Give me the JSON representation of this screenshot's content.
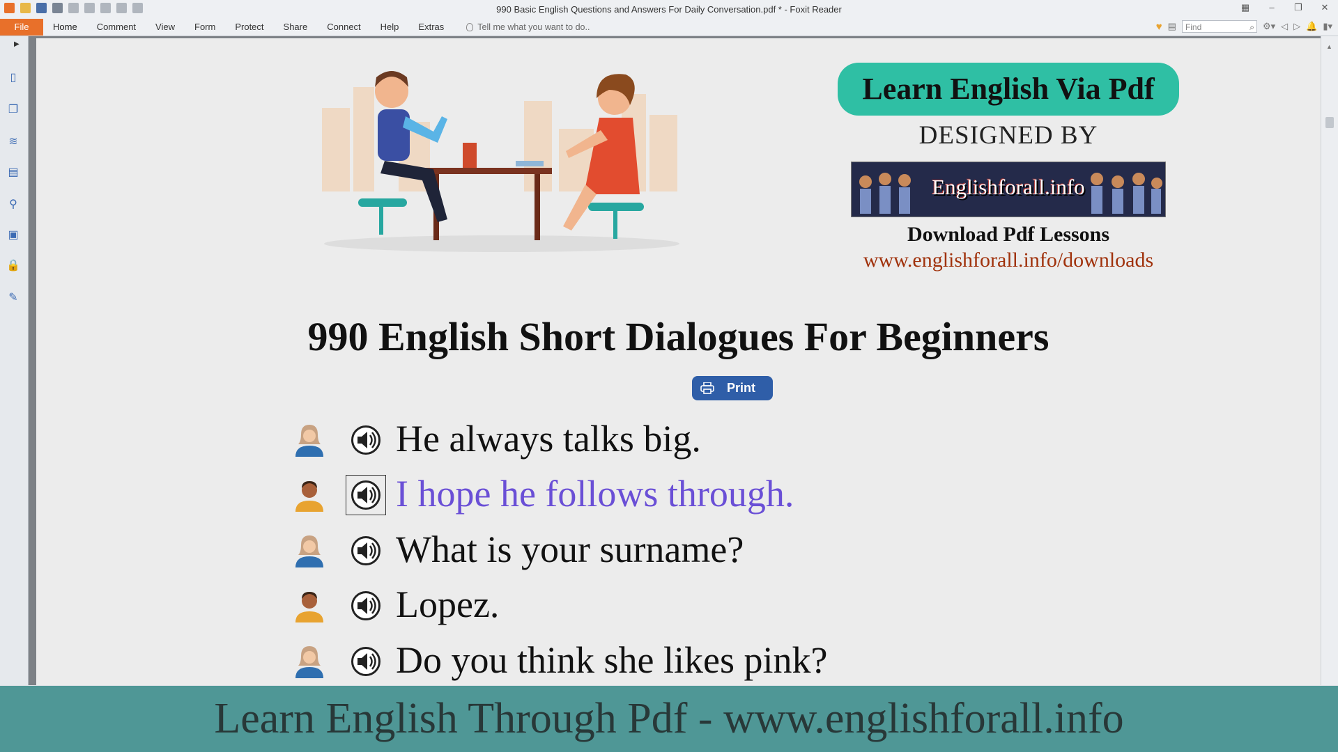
{
  "window": {
    "title": "990 Basic English Questions and Answers For Daily Conversation.pdf * - Foxit Reader"
  },
  "menu": {
    "file": "File",
    "items": [
      "Home",
      "Comment",
      "View",
      "Form",
      "Protect",
      "Share",
      "Connect",
      "Help",
      "Extras"
    ],
    "tell_me": "Tell me what you want to do..",
    "find_placeholder": "Find"
  },
  "document": {
    "brand_badge": "Learn English Via Pdf",
    "designed_by": "DESIGNED BY",
    "banner_text": "Englishforall.info",
    "download_title": "Download Pdf Lessons",
    "download_url": "www.englishforall.info/downloads",
    "main_title": "990 English Short Dialogues For Beginners",
    "print_label": "Print",
    "lines": [
      {
        "speaker": "female",
        "text": "He always talks big."
      },
      {
        "speaker": "male",
        "text": "I hope he follows through."
      },
      {
        "speaker": "female",
        "text": "What is your surname?"
      },
      {
        "speaker": "male",
        "text": "Lopez."
      },
      {
        "speaker": "female",
        "text": "Do you think she likes pink?"
      }
    ]
  },
  "footer": {
    "text": "Learn English Through Pdf - www.englishforall.info"
  },
  "colors": {
    "accent_orange": "#e8702a",
    "brand_teal": "#2fbfa4",
    "footer_teal": "#4f9796",
    "highlight_purple": "#6a4fd6",
    "url_red": "#a0320c"
  }
}
